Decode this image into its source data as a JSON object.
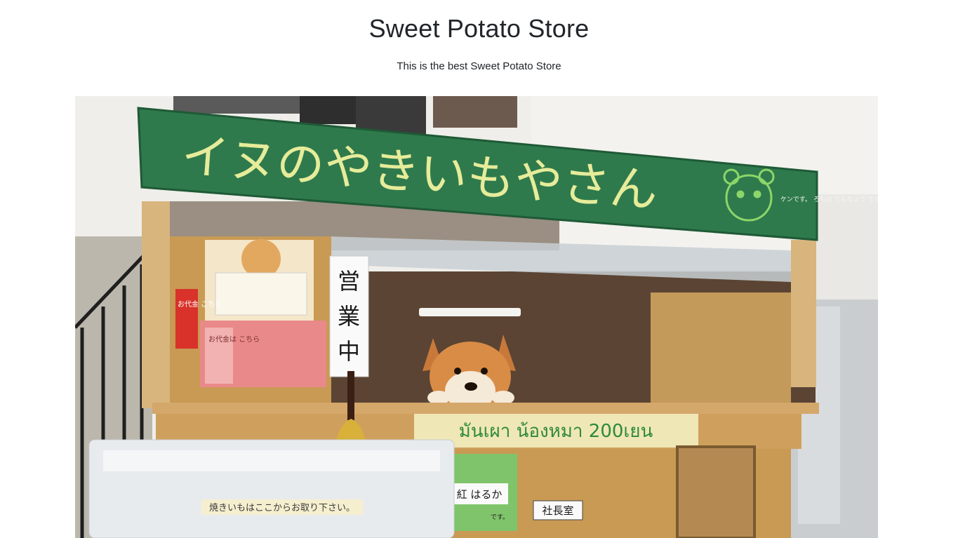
{
  "header": {
    "title": "Sweet Potato Store",
    "subtitle": "This is the best Sweet Potato Store"
  },
  "hero": {
    "sign_text": "イヌのやきいもやさん",
    "sign_note": "ケンです。 ろもの てんちょう です。",
    "vertical_sign": [
      "営",
      "業",
      "中"
    ],
    "counter_banner": "มันเผา น้องหมา 200เยน",
    "flyer_text": "お代金は こちら",
    "name_plate": "紅 はるか",
    "name_plate_suffix": "です。",
    "office_sign": "社長室",
    "box_label": "焼きいもはここからお取り下さい。",
    "left_label": "お代金 こちら"
  }
}
